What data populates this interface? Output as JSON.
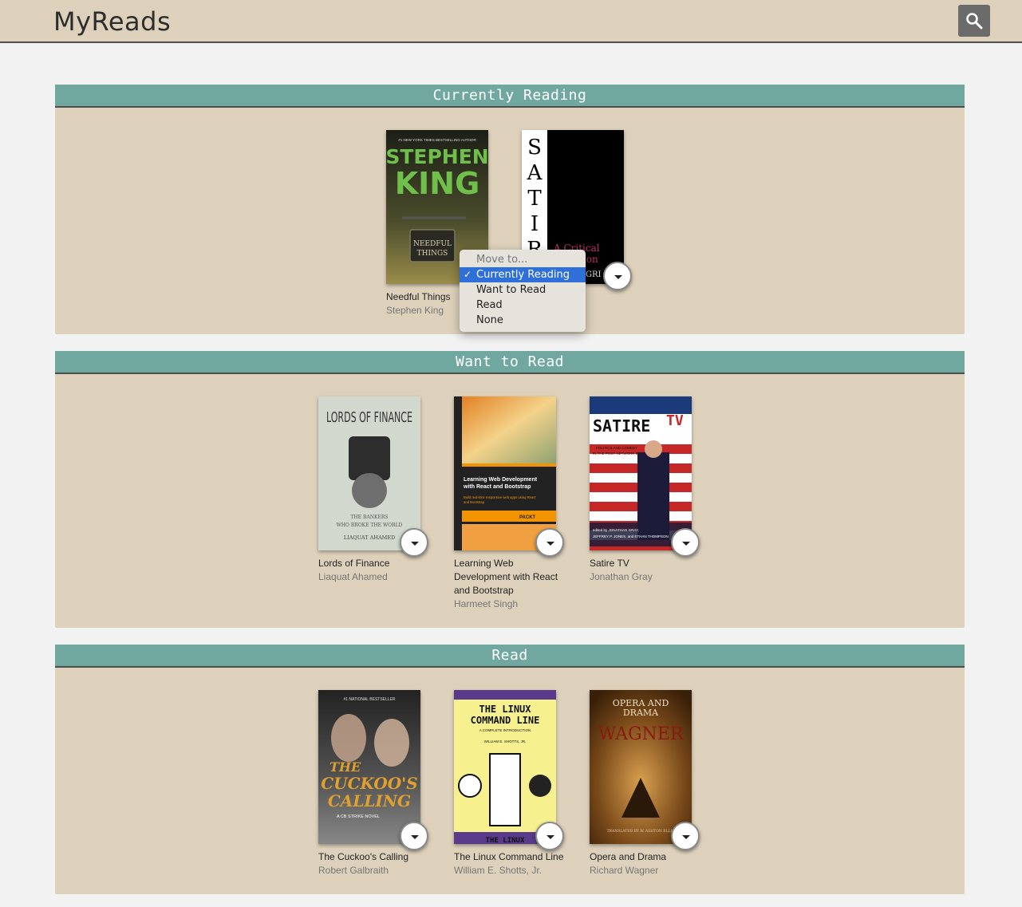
{
  "app": {
    "title": "MyReads"
  },
  "header": {
    "search_icon": "search-icon"
  },
  "shelves": [
    {
      "title": "Currently Reading",
      "books": [
        {
          "title": "Needful Things",
          "authors": "Stephen King",
          "cover": {
            "kicker": "#1 NEW YORK TIMES BESTSELLING AUTHOR",
            "author_line1": "STEPHEN",
            "author_line2": "KING",
            "sign1": "NEEDFUL",
            "sign2": "THINGS"
          }
        },
        {
          "title": "",
          "authors": "",
          "cover": {
            "letters": [
              "S",
              "A",
              "T",
              "I",
              "R"
            ],
            "sub1": "A Critical",
            "sub2": "duction",
            "sub3": "GRI"
          }
        }
      ]
    },
    {
      "title": "Want to Read",
      "books": [
        {
          "title": "Lords of Finance",
          "authors": "Liaquat Ahamed",
          "cover": {
            "headline": "LORDS OF FINANCE",
            "tag1": "THE BANKERS",
            "tag2": "WHO BROKE THE WORLD",
            "author": "LIAQUAT AHAMED"
          }
        },
        {
          "title": "Learning Web Development with React and Bootstrap",
          "title_lines": [
            "Learning Web",
            "Development with React",
            "and Bootstrap"
          ],
          "authors": "Harmeet Singh",
          "cover": {
            "l1": "Learning Web Development",
            "l2": "with React and Bootstrap",
            "l3": "Build real-time responsive web apps using React",
            "l4": "and Bootstrap",
            "brand": "PACKT"
          }
        },
        {
          "title": "Satire TV",
          "authors": "Jonathan Gray",
          "cover": {
            "w1": "SATIRE",
            "w2": "TV",
            "sub1": "POLITICS AND COMEDY",
            "sub2": "IN THE POST-NETWORK ERA",
            "ed1": "edited by JONATHAN GRAY,",
            "ed2": "JEFFREY P. JONES, and ETHAN THOMPSON"
          }
        }
      ]
    },
    {
      "title": "Read",
      "books": [
        {
          "title": "The Cuckoo's Calling",
          "authors": "Robert Galbraith",
          "cover": {
            "top": "#1 NATIONAL BESTSELLER",
            "t1": "THE",
            "t2": "CUCKOO'S",
            "t3": "CALLING",
            "t4": "A CB STRIKE NOVEL"
          }
        },
        {
          "title": "The Linux Command Line",
          "authors": "William E. Shotts, Jr.",
          "cover": {
            "t1": "THE LINUX",
            "t2": "COMMAND LINE",
            "t3": "A COMPLETE INTRODUCTION",
            "t4": "WILLIAM E. SHOTTS, JR.",
            "t5": "THE LINUX"
          }
        },
        {
          "title": "Opera and Drama",
          "authors": "Richard Wagner",
          "cover": {
            "t1": "OPERA AND",
            "t2": "DRAMA",
            "t3": "WAGNER",
            "t4": "TRANSLATED BY W. ASHTON ELLIS"
          }
        }
      ]
    }
  ],
  "shelf_menu": {
    "options": [
      "Move to...",
      "Currently Reading",
      "Want to Read",
      "Read",
      "None"
    ],
    "selected": "Currently Reading",
    "check": "✓"
  },
  "colors": {
    "header_bg": "#ddd1bb",
    "shelf_title_bg": "#70a8a0",
    "selected": "#2f6fd8"
  }
}
